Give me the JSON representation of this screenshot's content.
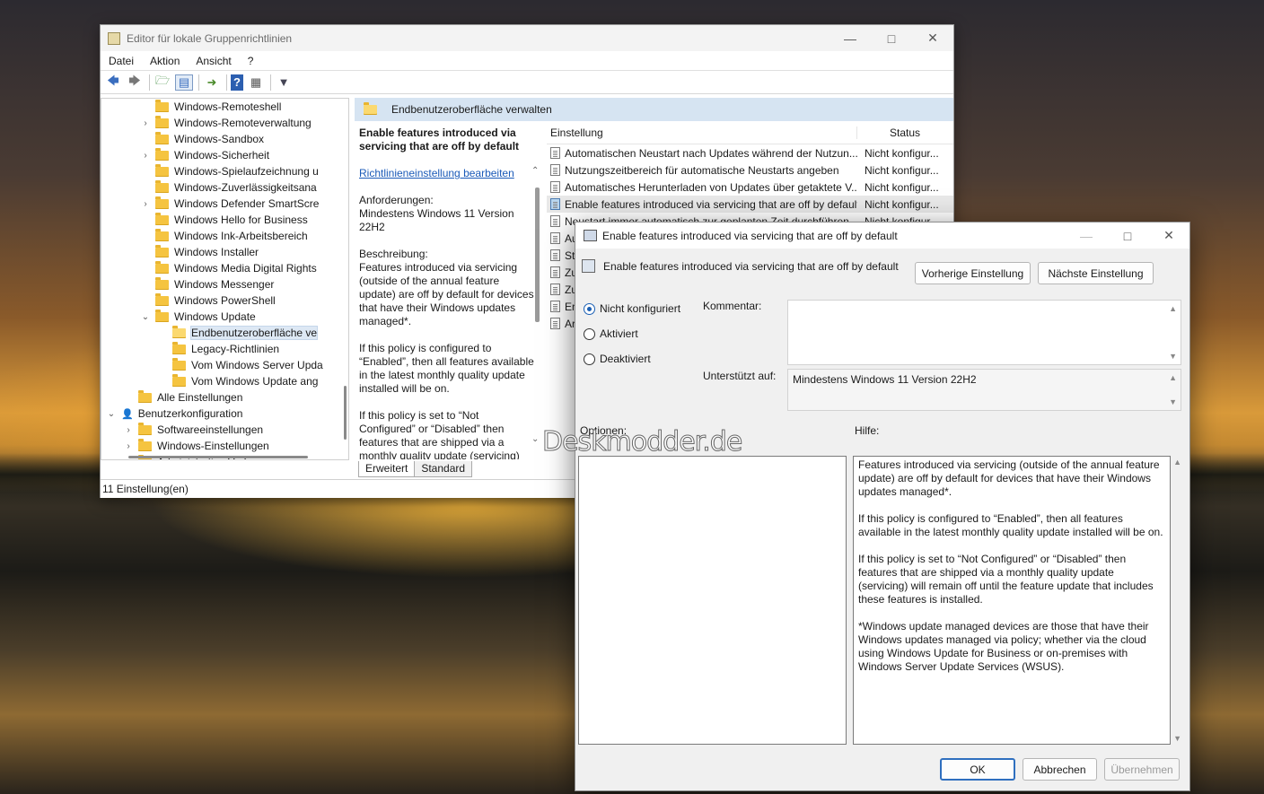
{
  "main_window": {
    "title": "Editor für lokale Gruppenrichtlinien",
    "menu": [
      "Datei",
      "Aktion",
      "Ansicht",
      "?"
    ],
    "tree": [
      {
        "label": "Windows-Remoteshell",
        "indent": 2,
        "chev": "",
        "icon": "folder"
      },
      {
        "label": "Windows-Remoteverwaltung",
        "indent": 2,
        "chev": "›",
        "icon": "folder"
      },
      {
        "label": "Windows-Sandbox",
        "indent": 2,
        "chev": "",
        "icon": "folder"
      },
      {
        "label": "Windows-Sicherheit",
        "indent": 2,
        "chev": "›",
        "icon": "folder"
      },
      {
        "label": "Windows-Spielaufzeichnung u",
        "indent": 2,
        "chev": "",
        "icon": "folder"
      },
      {
        "label": "Windows-Zuverlässigkeitsana",
        "indent": 2,
        "chev": "",
        "icon": "folder"
      },
      {
        "label": "Windows Defender SmartScre",
        "indent": 2,
        "chev": "›",
        "icon": "folder"
      },
      {
        "label": "Windows Hello for Business",
        "indent": 2,
        "chev": "",
        "icon": "folder"
      },
      {
        "label": "Windows Ink-Arbeitsbereich",
        "indent": 2,
        "chev": "",
        "icon": "folder"
      },
      {
        "label": "Windows Installer",
        "indent": 2,
        "chev": "",
        "icon": "folder"
      },
      {
        "label": "Windows Media Digital Rights",
        "indent": 2,
        "chev": "",
        "icon": "folder"
      },
      {
        "label": "Windows Messenger",
        "indent": 2,
        "chev": "",
        "icon": "folder"
      },
      {
        "label": "Windows PowerShell",
        "indent": 2,
        "chev": "",
        "icon": "folder"
      },
      {
        "label": "Windows Update",
        "indent": 2,
        "chev": "⌄",
        "icon": "folder"
      },
      {
        "label": "Endbenutzeroberfläche ve",
        "indent": 3,
        "chev": "",
        "icon": "folder-open",
        "selected": true
      },
      {
        "label": "Legacy-Richtlinien",
        "indent": 3,
        "chev": "",
        "icon": "folder"
      },
      {
        "label": "Vom Windows Server Upda",
        "indent": 3,
        "chev": "",
        "icon": "folder"
      },
      {
        "label": "Vom Windows Update ang",
        "indent": 3,
        "chev": "",
        "icon": "folder"
      },
      {
        "label": "Alle Einstellungen",
        "indent": 1,
        "chev": "",
        "icon": "folder"
      },
      {
        "label": "Benutzerkonfiguration",
        "indent": 0,
        "chev": "⌄",
        "icon": "user"
      },
      {
        "label": "Softwareeinstellungen",
        "indent": 1,
        "chev": "›",
        "icon": "folder"
      },
      {
        "label": "Windows-Einstellungen",
        "indent": 1,
        "chev": "›",
        "icon": "folder"
      },
      {
        "label": "Administrative Vorlagen",
        "indent": 1,
        "chev": "›",
        "icon": "folder"
      }
    ],
    "detail_header": "Endbenutzeroberfläche verwalten",
    "description": {
      "heading": "Enable features introduced via servicing that are off by default",
      "edit_link": "Richtlinieneinstellung bearbeiten",
      "requirements_label": "Anforderungen:",
      "requirements": "Mindestens Windows 11 Version 22H2",
      "description_label": "Beschreibung:",
      "p1": "Features introduced via servicing (outside of the annual feature update) are off by default for devices that have their Windows updates managed*.",
      "p2": "If this policy is configured to “Enabled”, then all features available in the latest monthly quality update installed will be on.",
      "p3": "If this policy is set to “Not Configured” or “Disabled” then features that are shipped via a monthly quality update (servicing)"
    },
    "tabs": [
      "Erweitert",
      "Standard"
    ],
    "list_headers": {
      "setting": "Einstellung",
      "status": "Status"
    },
    "settings": [
      {
        "name": "Automatischen Neustart nach Updates während der Nutzun...",
        "status": "Nicht konfigur..."
      },
      {
        "name": "Nutzungszeitbereich für automatische Neustarts angeben",
        "status": "Nicht konfigur..."
      },
      {
        "name": "Automatisches Herunterladen von Updates über getaktete V...",
        "status": "Nicht konfigur..."
      },
      {
        "name": "Enable features introduced via servicing that are off by default",
        "status": "Nicht konfigur...",
        "selected": true
      },
      {
        "name": "Neustart immer automatisch zur geplanten Zeit durchführen",
        "status": "Nicht konfigur..."
      },
      {
        "name": "Au",
        "status": ""
      },
      {
        "name": "Sti",
        "status": ""
      },
      {
        "name": "Zu",
        "status": ""
      },
      {
        "name": "Zu",
        "status": ""
      },
      {
        "name": "En",
        "status": ""
      },
      {
        "name": "Ar",
        "status": ""
      }
    ],
    "status_bar": "11 Einstellung(en)"
  },
  "dialog": {
    "title": "Enable features introduced via servicing that are off by default",
    "policy_name": "Enable features introduced via servicing that are off by default",
    "prev_button": "Vorherige Einstellung",
    "next_button": "Nächste Einstellung",
    "radios": [
      {
        "label": "Nicht konfiguriert",
        "checked": true
      },
      {
        "label": "Aktiviert",
        "checked": false
      },
      {
        "label": "Deaktiviert",
        "checked": false
      }
    ],
    "comment_label": "Kommentar:",
    "comment_value": "",
    "supported_label": "Unterstützt auf:",
    "supported_value": "Mindestens Windows 11 Version 22H2",
    "options_label": "Optionen:",
    "help_label": "Hilfe:",
    "help": [
      "Features introduced via servicing (outside of the annual feature update) are off by default for devices that have their Windows updates managed*.",
      "If this policy is configured to “Enabled”, then all features available in the latest monthly quality update installed will be on.",
      "If this policy is set to “Not Configured” or “Disabled” then features that are shipped via a monthly quality update (servicing) will remain off until the feature update that includes these features is installed.",
      " *Windows update managed devices are those that have their Windows updates managed via policy; whether via the cloud using Windows Update for Business or on-premises with Windows Server Update Services (WSUS)."
    ],
    "ok": "OK",
    "cancel": "Abbrechen",
    "apply": "Übernehmen"
  },
  "watermark": "Deskmodder.de"
}
